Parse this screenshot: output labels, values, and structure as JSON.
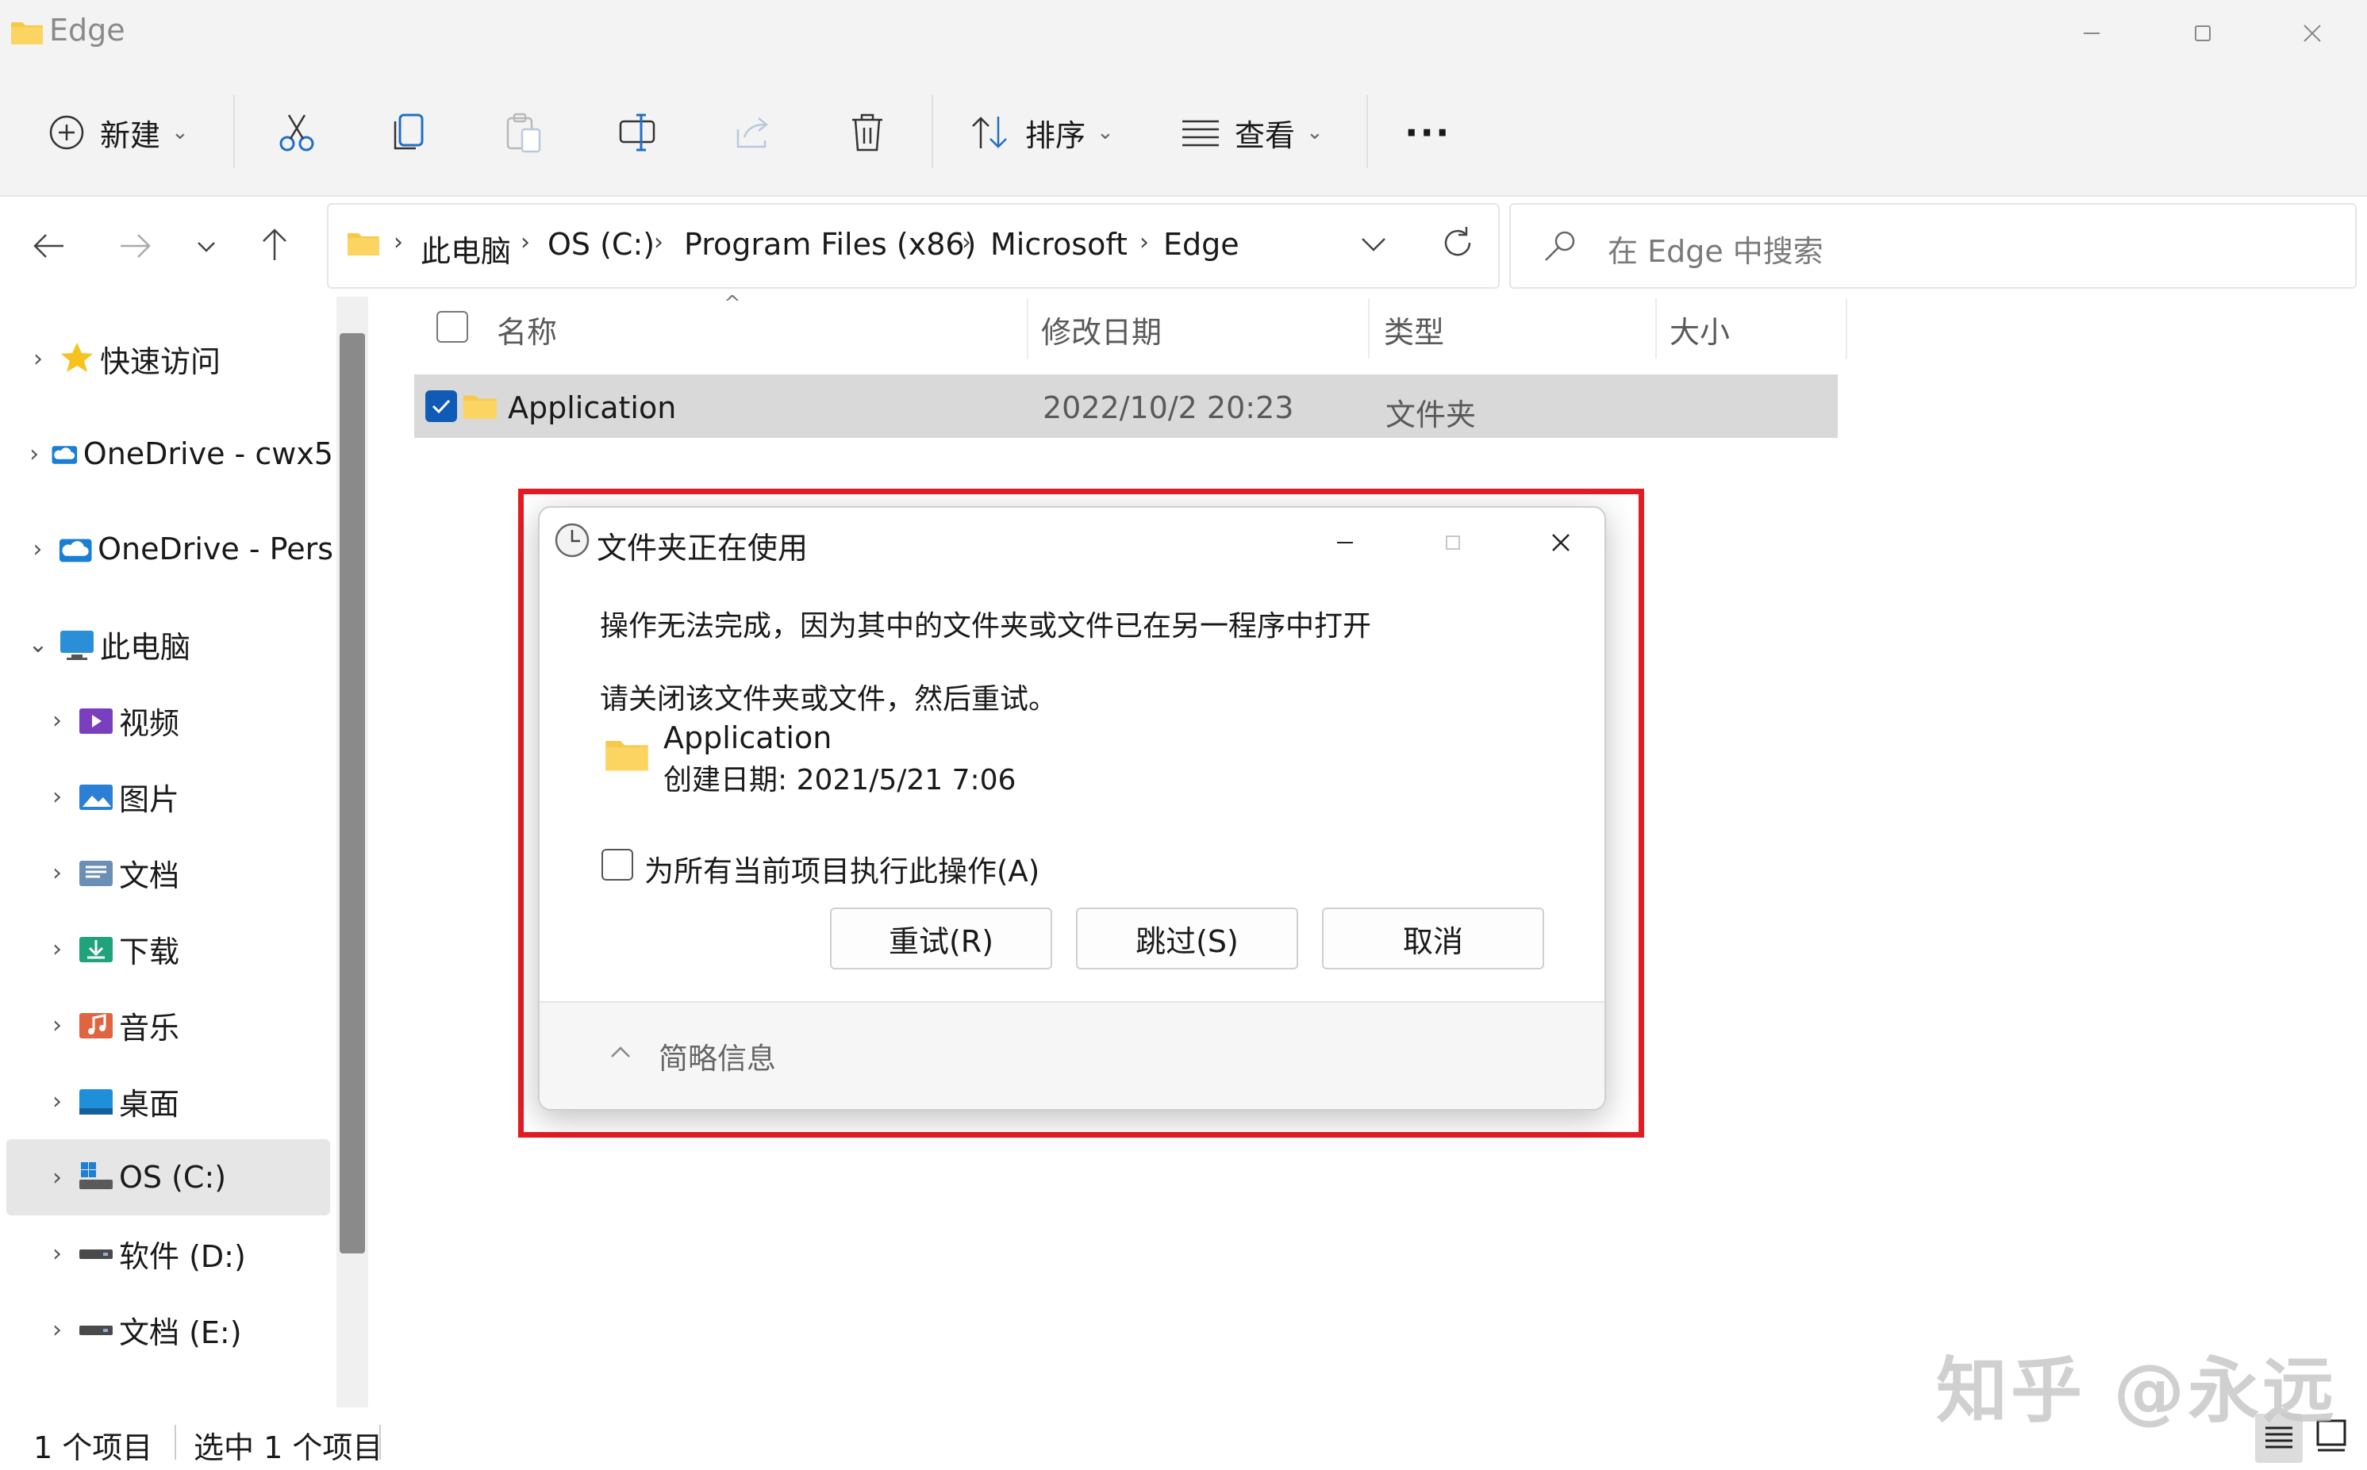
{
  "window": {
    "title": "Edge"
  },
  "toolbar": {
    "new_label": "新建",
    "sort_label": "排序",
    "view_label": "查看",
    "more_label": "···"
  },
  "address": {
    "crumbs": [
      "此电脑",
      "OS (C:)",
      "Program Files (x86)",
      "Microsoft",
      "Edge"
    ]
  },
  "search": {
    "placeholder": "在 Edge 中搜索"
  },
  "nav": {
    "items": [
      {
        "label": "快速访问",
        "icon": "star-icon"
      },
      {
        "label": "OneDrive - cwx5",
        "icon": "onedrive-icon"
      },
      {
        "label": "OneDrive - Pers",
        "icon": "onedrive-icon"
      },
      {
        "label": "此电脑",
        "icon": "computer-icon"
      },
      {
        "label": "视频",
        "icon": "video-folder-icon"
      },
      {
        "label": "图片",
        "icon": "pictures-folder-icon"
      },
      {
        "label": "文档",
        "icon": "documents-folder-icon"
      },
      {
        "label": "下载",
        "icon": "downloads-folder-icon"
      },
      {
        "label": "音乐",
        "icon": "music-folder-icon"
      },
      {
        "label": "桌面",
        "icon": "desktop-folder-icon"
      },
      {
        "label": "OS (C:)",
        "icon": "windows-drive-icon"
      },
      {
        "label": "软件 (D:)",
        "icon": "drive-icon"
      },
      {
        "label": "文档 (E:)",
        "icon": "drive-icon"
      }
    ]
  },
  "list": {
    "columns": [
      "名称",
      "修改日期",
      "类型",
      "大小"
    ],
    "rows": [
      {
        "name": "Application",
        "modified": "2022/10/2 20:23",
        "type": "文件夹",
        "size": ""
      }
    ]
  },
  "status": {
    "count": "1 个项目",
    "selected": "选中 1 个项目"
  },
  "dialog": {
    "title": "文件夹正在使用",
    "message1": "操作无法完成，因为其中的文件夹或文件已在另一程序中打开",
    "message2": "请关闭该文件夹或文件，然后重试。",
    "item_name": "Application",
    "item_created": "创建日期: 2021/5/21 7:06",
    "checkbox_label": "为所有当前项目执行此操作(A)",
    "retry_label": "重试(R)",
    "skip_label": "跳过(S)",
    "cancel_label": "取消",
    "details_label": "简略信息"
  },
  "watermark": "知乎 @永远",
  "colors": {
    "highlight": "#e51b24",
    "folder": "#f7c94b",
    "accent": "#0f6cbd"
  }
}
